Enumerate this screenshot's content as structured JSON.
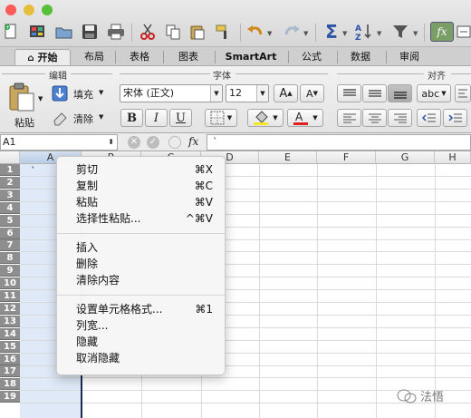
{
  "toolbar": {
    "icons": [
      "new-document",
      "templates",
      "open",
      "save",
      "print",
      "cut",
      "copy",
      "paste",
      "format-painter",
      "undo",
      "redo",
      "autosum",
      "sort",
      "filter",
      "formula-builder"
    ],
    "colors": {
      "close": "#fc5b57",
      "minimize": "#e5bf3c",
      "zoom": "#57c038"
    }
  },
  "tabs": {
    "home": "开始",
    "layout": "布局",
    "tables": "表格",
    "charts": "图表",
    "smartart": "SmartArt",
    "formulas": "公式",
    "data": "数据",
    "review": "审阅"
  },
  "ribbon": {
    "edit_group": "编辑",
    "font_group": "字体",
    "align_group": "对齐",
    "paste": "粘贴",
    "fill": "填充",
    "clear": "清除",
    "font_name": "宋体 (正文)",
    "font_size": "12",
    "grow": "A",
    "shrink": "A",
    "bold": "B",
    "italic": "I",
    "underline": "U",
    "wrap": "abc",
    "font_color_bar": "#e02020",
    "highlight_bar": "#f5e625"
  },
  "formula_bar": {
    "name_box": "A1",
    "fx": "fx",
    "content": "`"
  },
  "grid": {
    "columns": [
      "A",
      "B",
      "C",
      "D",
      "E",
      "F",
      "G",
      "H"
    ],
    "rows": [
      "1",
      "2",
      "3",
      "4",
      "5",
      "6",
      "7",
      "8",
      "9",
      "10",
      "11",
      "12",
      "13",
      "14",
      "15",
      "16",
      "17",
      "18",
      "19"
    ],
    "a1_value": "`"
  },
  "context_menu": {
    "items": [
      {
        "label": "剪切",
        "shortcut": "⌘X"
      },
      {
        "label": "复制",
        "shortcut": "⌘C"
      },
      {
        "label": "粘贴",
        "shortcut": "⌘V"
      },
      {
        "label": "选择性粘贴...",
        "shortcut": "^⌘V"
      },
      {
        "label": "插入",
        "shortcut": ""
      },
      {
        "label": "删除",
        "shortcut": ""
      },
      {
        "label": "清除内容",
        "shortcut": ""
      },
      {
        "label": "设置单元格格式...",
        "shortcut": "⌘1"
      },
      {
        "label": "列宽...",
        "shortcut": ""
      },
      {
        "label": "隐藏",
        "shortcut": ""
      },
      {
        "label": "取消隐藏",
        "shortcut": ""
      }
    ]
  },
  "watermark": "法悟"
}
